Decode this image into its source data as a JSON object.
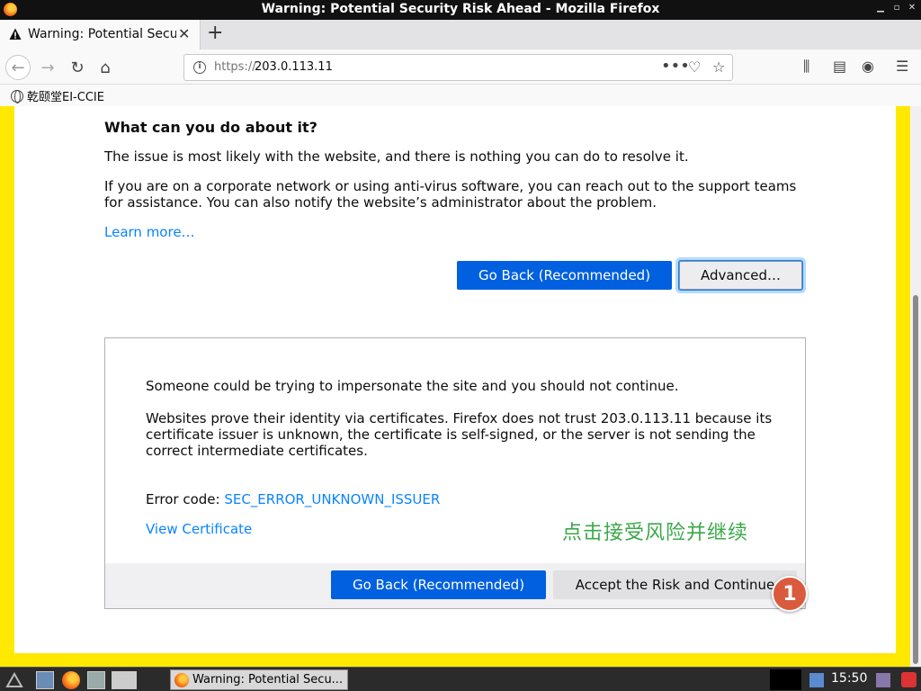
{
  "window": {
    "title": "Warning: Potential Security Risk Ahead - Mozilla Firefox"
  },
  "tabs": [
    {
      "label": "Warning: Potential Security Risk Ahead",
      "icon": "warning-icon"
    }
  ],
  "navbar": {
    "url_scheme": "https://",
    "url_host": "203.0.113.11"
  },
  "bookmarks": [
    {
      "label": "乾颐堂EI-CCIE",
      "icon": "globe-icon"
    }
  ],
  "page": {
    "heading": "What can you do about it?",
    "para1": "The issue is most likely with the website, and there is nothing you can do to resolve it.",
    "para2": "If you are on a corporate network or using anti-virus software, you can reach out to the support teams for assistance. You can also notify the website’s administrator about the problem.",
    "learn_more": "Learn more…",
    "go_back_label": "Go Back (Recommended)",
    "advanced_label": "Advanced…",
    "advanced": {
      "line1": "Someone could be trying to impersonate the site and you should not continue.",
      "line2": "Websites prove their identity via certificates. Firefox does not trust 203.0.113.11 because its certificate issuer is unknown, the certificate is self-signed, or the server is not sending the correct intermediate certificates.",
      "error_code_label": "Error code: ",
      "error_code": "SEC_ERROR_UNKNOWN_ISSUER",
      "view_certificate": "View Certificate",
      "go_back_label": "Go Back (Recommended)",
      "accept_label": "Accept the Risk and Continue"
    },
    "annotation_text": "点击接受风险并继续",
    "annotation_badge": "1"
  },
  "taskbar": {
    "task_label": "Warning: Potential Secu...",
    "clock": "15:50"
  },
  "colors": {
    "warning_border": "#ffe900",
    "primary_button": "#0060df",
    "link": "#0a84ff",
    "annotation_green": "#3ca84a",
    "badge": "#d95a3d"
  }
}
